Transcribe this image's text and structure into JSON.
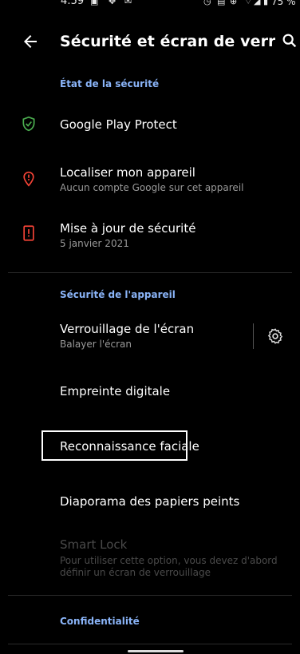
{
  "status_bar": {
    "time": "4:59",
    "battery": "75 %"
  },
  "app_bar": {
    "title": "Sécurité et écran de verrouill…"
  },
  "sections": {
    "security_status": {
      "header": "État de la sécurité",
      "items": [
        {
          "title": "Google Play Protect",
          "color": "#4caf50",
          "icon": "shield-check-icon"
        },
        {
          "title": "Localiser mon appareil",
          "subtitle": "Aucun compte Google sur cet appareil",
          "color": "#f44336",
          "icon": "location-alert-icon"
        },
        {
          "title": "Mise à jour de sécurité",
          "subtitle": "5 janvier 2021",
          "color": "#f44336",
          "icon": "phone-alert-icon"
        }
      ]
    },
    "device_security": {
      "header": "Sécurité de l'appareil",
      "items": [
        {
          "title": "Verrouillage de l'écran",
          "subtitle": "Balayer l'écran"
        },
        {
          "title": "Empreinte digitale"
        },
        {
          "title": "Reconnaissance faciale"
        },
        {
          "title": "Diaporama des papiers peints"
        },
        {
          "title": "Smart Lock",
          "subtitle_line1": "Pour utiliser cette option, vous devez d'abord",
          "subtitle_line2": "définir un écran de verrouillage",
          "disabled": true
        }
      ]
    },
    "privacy": {
      "header": "Confidentialité"
    }
  }
}
